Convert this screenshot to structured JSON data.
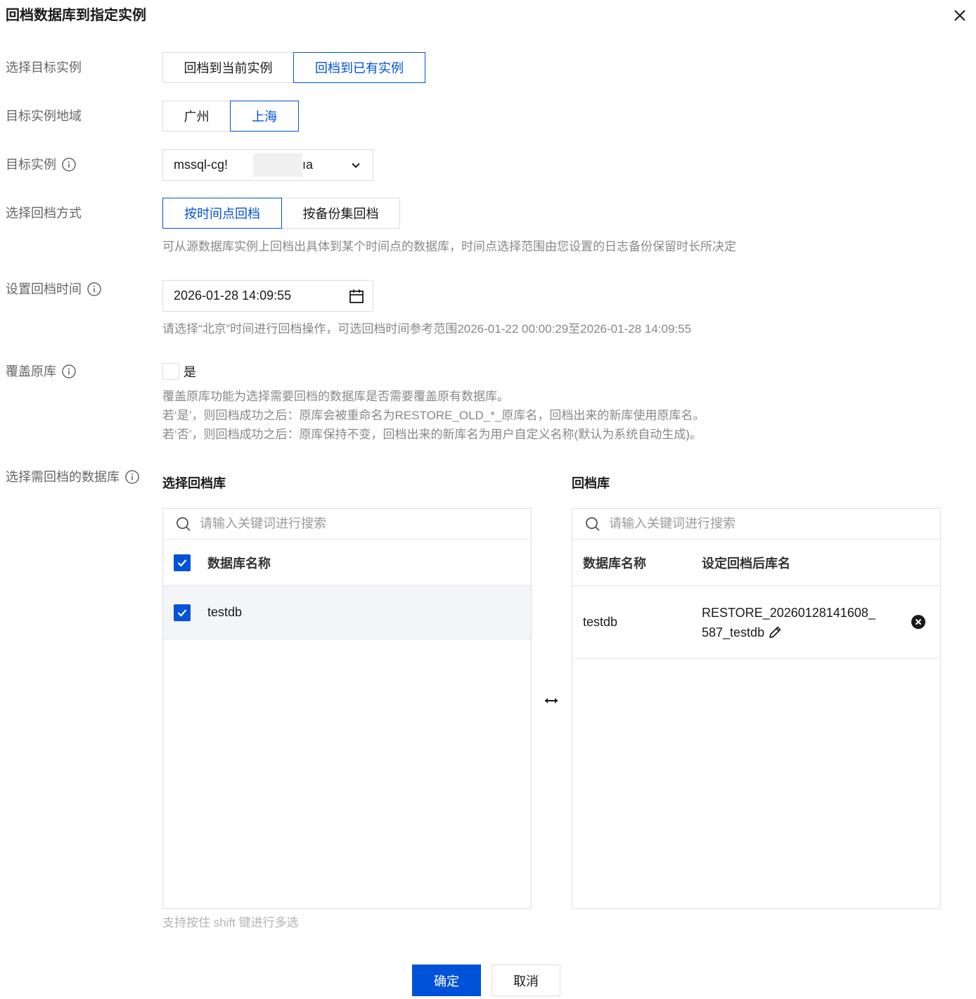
{
  "dialog": {
    "title": "回档数据库到指定实例"
  },
  "fields": {
    "target_mode": {
      "label": "选择目标实例",
      "options": [
        "回档到当前实例",
        "回档到已有实例"
      ],
      "selected": "回档到已有实例"
    },
    "region": {
      "label": "目标实例地域",
      "options": [
        "广州",
        "上海"
      ],
      "selected": "上海"
    },
    "instance": {
      "label": "目标实例",
      "value_prefix": "mssql-cg!",
      "value_suffix": "ıa"
    },
    "method": {
      "label": "选择回档方式",
      "options": [
        "按时间点回档",
        "按备份集回档"
      ],
      "selected": "按时间点回档",
      "help": "可从源数据库实例上回档出具体到某个时间点的数据库，时间点选择范围由您设置的日志备份保留时长所决定"
    },
    "time": {
      "label": "设置回档时间",
      "value": "2026-01-28 14:09:55",
      "help": "请选择“北京”时间进行回档操作，可选回档时间参考范围2026-01-22 00:00:29至2026-01-28 14:09:55"
    },
    "overwrite": {
      "label": "覆盖原库",
      "option": "是",
      "checked": false,
      "help": [
        "覆盖原库功能为选择需要回档的数据库是否需要覆盖原有数据库。",
        "若‘是’，则回档成功之后：原库会被重命名为RESTORE_OLD_*_原库名，回档出来的新库使用原库名。",
        "若‘否’，则回档成功之后：原库保持不变，回档出来的新库名为用户自定义名称(默认为系统自动生成)。"
      ]
    },
    "databases": {
      "label": "选择需回档的数据库"
    }
  },
  "left_panel": {
    "title": "选择回档库",
    "search_placeholder": "请输入关键词进行搜索",
    "column": "数据库名称",
    "rows": [
      {
        "name": "testdb",
        "checked": true
      }
    ]
  },
  "right_panel": {
    "title": "回档库",
    "search_placeholder": "请输入关键词进行搜索",
    "columns": [
      "数据库名称",
      "设定回档后库名"
    ],
    "rows": [
      {
        "name": "testdb",
        "target_line1": "RESTORE_20260128141608_",
        "target_line2": "587_testdb"
      }
    ]
  },
  "tip": "支持按住 shift 键进行多选",
  "footer": {
    "confirm": "确定",
    "cancel": "取消"
  },
  "colors": {
    "primary": "#0052d9",
    "border": "#dcdcdc",
    "muted": "#888888"
  }
}
